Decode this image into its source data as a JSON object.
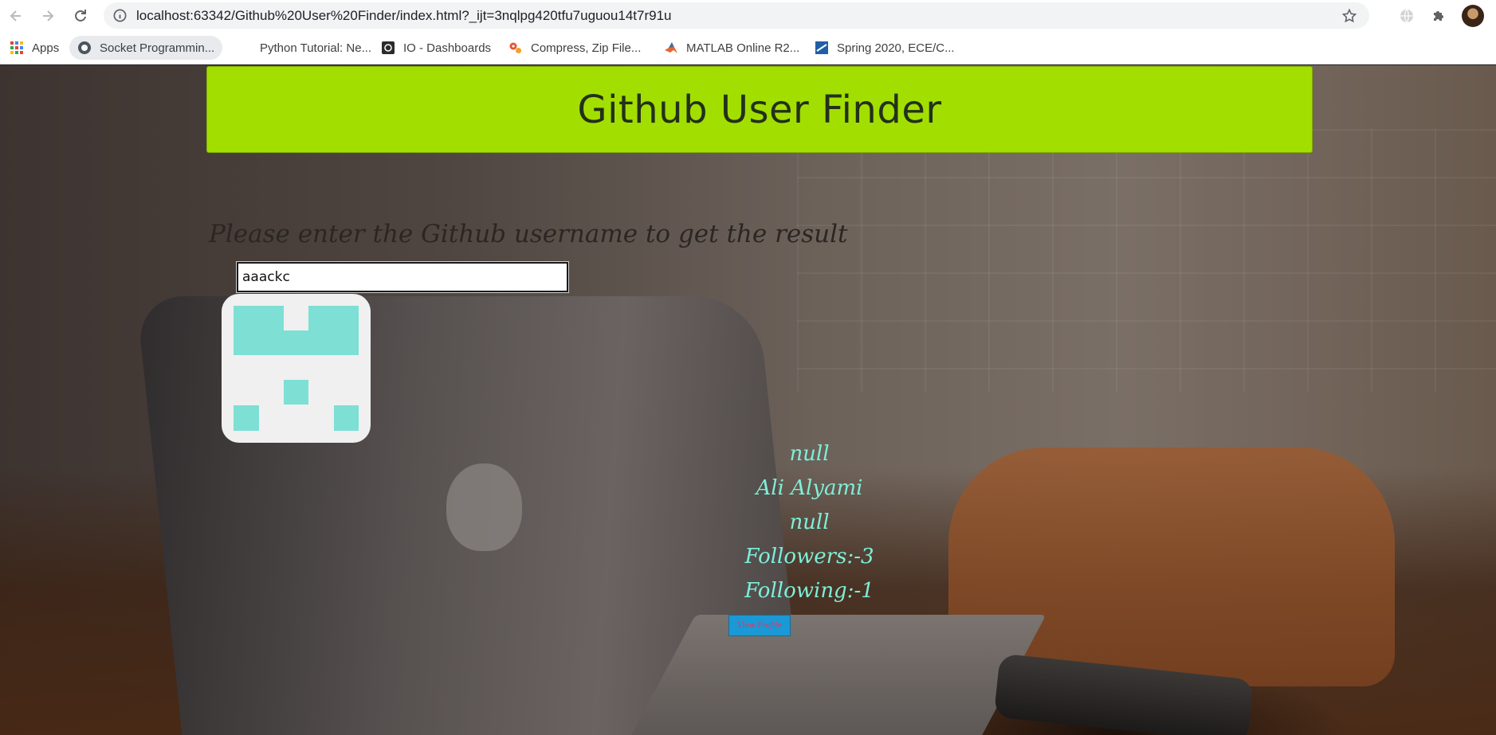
{
  "browser": {
    "url": "localhost:63342/Github%20User%20Finder/index.html?_ijt=3nqlpg420tfu7uguou14t7r91u",
    "bookmarks": [
      {
        "label": "Apps",
        "icon": "apps-grid-icon"
      },
      {
        "label": "Socket Programmin...",
        "icon": "socket-site-icon"
      },
      {
        "label": "Python Tutorial: Ne...",
        "icon": "blank-page-icon"
      },
      {
        "label": "IO - Dashboards",
        "icon": "io-dashboard-icon"
      },
      {
        "label": "Compress, Zip File...",
        "icon": "compress-gears-icon"
      },
      {
        "label": "MATLAB Online R2...",
        "icon": "matlab-icon"
      },
      {
        "label": "Spring 2020, ECE/C...",
        "icon": "course-site-icon"
      }
    ]
  },
  "app": {
    "title": "Github User Finder",
    "prompt": "Please enter the Github username to get the result",
    "search": {
      "value": "aaackc",
      "placeholder": ""
    },
    "profile": {
      "line1": "null",
      "name": "Ali Alyami",
      "line3": "null",
      "followers": "Followers:-3",
      "following": "Following:-1",
      "view_button": "View Profile"
    },
    "colors": {
      "banner": "#a2df00",
      "info_text": "#7eefd8",
      "button": "#1a99d6",
      "avatar_pixel": "#7edfd4"
    }
  }
}
